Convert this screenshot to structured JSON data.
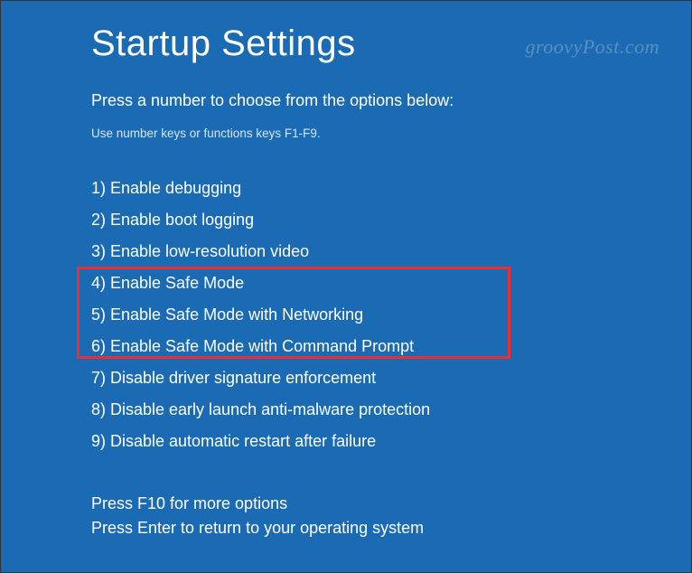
{
  "title": "Startup Settings",
  "subtitle": "Press a number to choose from the options below:",
  "hint": "Use number keys or functions keys F1-F9.",
  "options": [
    "1) Enable debugging",
    "2) Enable boot logging",
    "3) Enable low-resolution video",
    "4) Enable Safe Mode",
    "5) Enable Safe Mode with Networking",
    "6) Enable Safe Mode with Command Prompt",
    "7) Disable driver signature enforcement",
    "8) Disable early launch anti-malware protection",
    "9) Disable automatic restart after failure"
  ],
  "footer": {
    "line1": "Press F10 for more options",
    "line2": "Press Enter to return to your operating system"
  },
  "watermark": "groovyPost.com"
}
